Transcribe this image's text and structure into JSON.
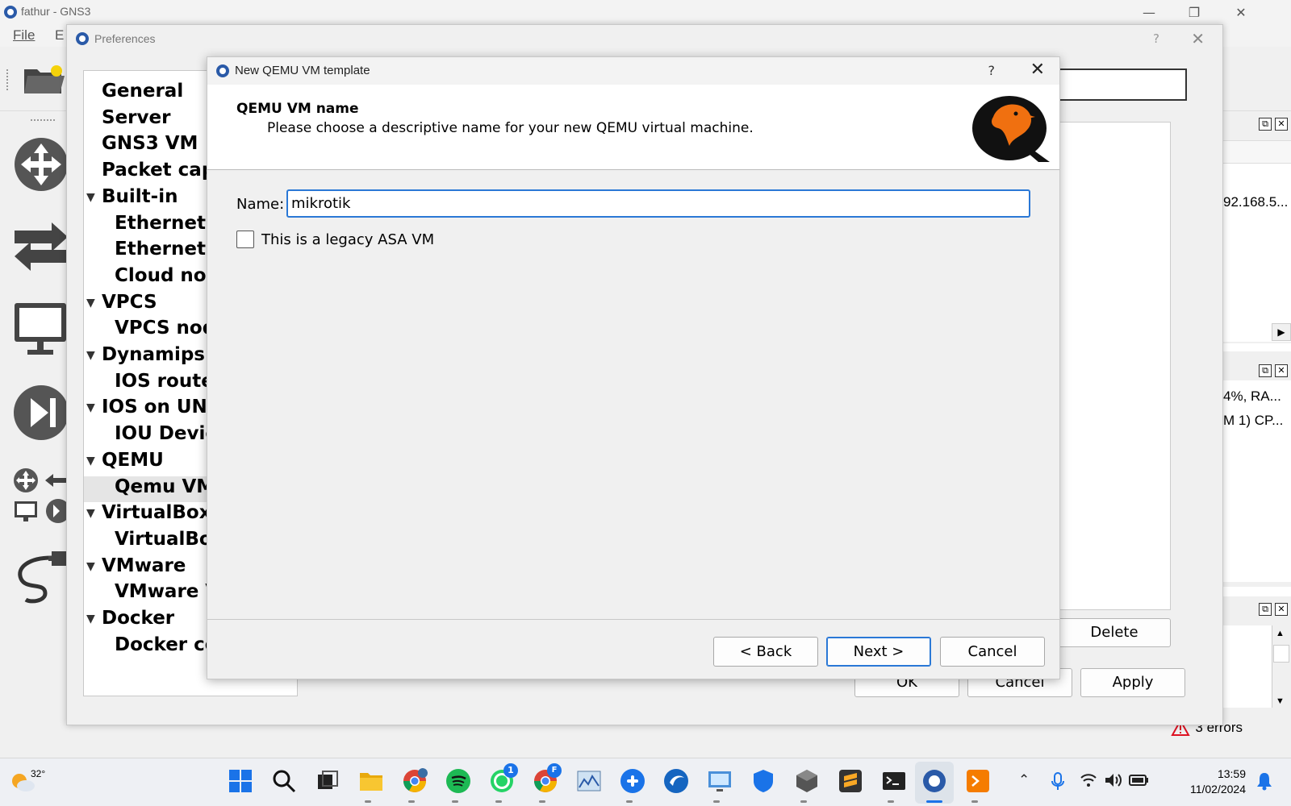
{
  "main_window": {
    "title": "fathur - GNS3",
    "menus": [
      "File",
      "E"
    ]
  },
  "right_docks": {
    "topology_text": "92.168.5...",
    "console_line1": "4%, RA...",
    "console_line2": "M 1) CP..."
  },
  "status": {
    "errors": "3 errors"
  },
  "preferences": {
    "title": "Preferences",
    "help": "?",
    "close": "✕",
    "tree": [
      {
        "label": "General",
        "level": "top",
        "arrow": ""
      },
      {
        "label": "Server",
        "level": "top",
        "arrow": ""
      },
      {
        "label": "GNS3 VM",
        "level": "top",
        "arrow": ""
      },
      {
        "label": "Packet capt",
        "level": "top",
        "arrow": ""
      },
      {
        "label": "Built-in",
        "level": "top",
        "arrow": "▼"
      },
      {
        "label": "Ethernet h",
        "level": "child",
        "arrow": ""
      },
      {
        "label": "Ethernet sv",
        "level": "child",
        "arrow": ""
      },
      {
        "label": "Cloud nod",
        "level": "child",
        "arrow": ""
      },
      {
        "label": "VPCS",
        "level": "top",
        "arrow": "▼"
      },
      {
        "label": "VPCS node",
        "level": "child",
        "arrow": ""
      },
      {
        "label": "Dynamips",
        "level": "top",
        "arrow": "▼"
      },
      {
        "label": "IOS router",
        "level": "child",
        "arrow": ""
      },
      {
        "label": "IOS on UNIX",
        "level": "top",
        "arrow": "▼"
      },
      {
        "label": "IOU Device",
        "level": "child",
        "arrow": ""
      },
      {
        "label": "QEMU",
        "level": "top",
        "arrow": "▼"
      },
      {
        "label": "Qemu VMs",
        "level": "child",
        "arrow": "",
        "selected": true
      },
      {
        "label": "VirtualBox",
        "level": "top",
        "arrow": "▼"
      },
      {
        "label": "VirtualBox",
        "level": "child",
        "arrow": ""
      },
      {
        "label": "VMware",
        "level": "top",
        "arrow": "▼"
      },
      {
        "label": "VMware V",
        "level": "child",
        "arrow": ""
      },
      {
        "label": "Docker",
        "level": "top",
        "arrow": "▼"
      },
      {
        "label": "Docker co",
        "level": "child",
        "arrow": ""
      }
    ],
    "delete_label": "Delete",
    "ok_label": "OK",
    "cancel_label": "Cancel",
    "apply_label": "Apply"
  },
  "wizard": {
    "title": "New QEMU VM template",
    "help": "?",
    "close": "✕",
    "header_title": "QEMU VM name",
    "header_subtitle": "Please choose a descriptive name for your new QEMU virtual machine.",
    "name_label": "Name:",
    "name_value": "mikrotik",
    "legacy_label": "This is a legacy ASA VM",
    "legacy_checked": false,
    "back_label": "< Back",
    "next_label": "Next >",
    "cancel_label": "Cancel"
  },
  "taskbar": {
    "temperature": "32°",
    "whatsapp_badge": "1",
    "chrome2_badge": "F",
    "time": "13:59",
    "date": "11/02/2024"
  }
}
